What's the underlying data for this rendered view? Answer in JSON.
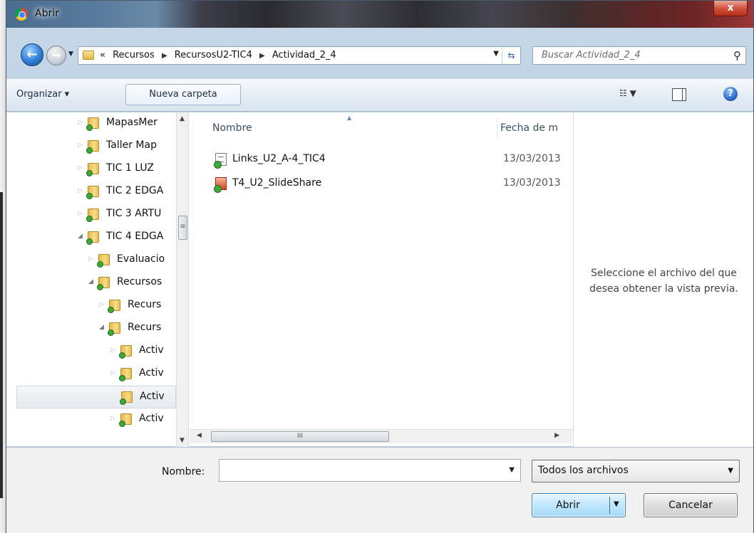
{
  "window": {
    "title": "Abrir",
    "close_label": "x"
  },
  "address": {
    "overflow": "«",
    "crumbs": [
      "Recursos",
      "RecursosU2-TIC4",
      "Actividad_2_4"
    ],
    "search_placeholder": "Buscar Actividad_2_4"
  },
  "toolbar": {
    "organize_label": "Organizar ▾",
    "new_folder_label": "Nueva carpeta"
  },
  "tree": {
    "items": [
      {
        "label": "MapasMer"
      },
      {
        "label": "Taller Map"
      },
      {
        "label": "TIC 1 LUZ"
      },
      {
        "label": "TIC 2 EDGA"
      },
      {
        "label": "TIC 3 ARTU"
      },
      {
        "label": "TIC 4 EDGA"
      },
      {
        "label": "Evaluacio"
      },
      {
        "label": "Recursos"
      },
      {
        "label": "Recurs"
      },
      {
        "label": "Recurs"
      },
      {
        "label": "Activ"
      },
      {
        "label": "Activ"
      },
      {
        "label": "Activ"
      },
      {
        "label": "Activ"
      }
    ]
  },
  "files": {
    "columns": {
      "name": "Nombre",
      "date": "Fecha de m"
    },
    "rows": [
      {
        "name": "Links_U2_A-4_TIC4",
        "date": "13/03/2013",
        "type": "text-file-icon"
      },
      {
        "name": "T4_U2_SlideShare",
        "date": "13/03/2013",
        "type": "powerpoint-file-icon"
      }
    ]
  },
  "preview": {
    "line1": "Seleccione el archivo del que",
    "line2": "desea obtener la vista previa."
  },
  "bottom": {
    "name_label": "Nombre:",
    "name_value": "",
    "filter_value": "Todos los archivos",
    "open_label": "Abrir",
    "cancel_label": "Cancelar"
  },
  "colors": {
    "accent": "#3c7fb1",
    "folder": "#f6dc85",
    "sync_check": "#3ea93a"
  }
}
